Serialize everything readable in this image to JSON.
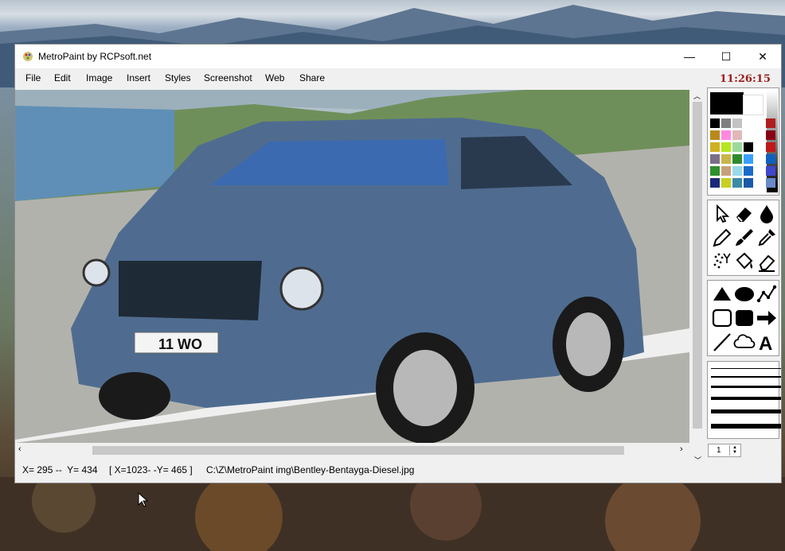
{
  "window": {
    "title": "MetroPaint by RCPsoft.net",
    "controls": {
      "minimize": "—",
      "maximize": "☐",
      "close": "✕"
    }
  },
  "menu": [
    "File",
    "Edit",
    "Image",
    "Insert",
    "Styles",
    "Screenshot",
    "Web",
    "Share"
  ],
  "status": {
    "cursor": "X= 295 --  Y= 434",
    "size": "[ X=1023- -Y= 465 ]",
    "path": "C:\\Z\\MetroPaint img\\Bentley-Bentayga-Diesel.jpg"
  },
  "panel": {
    "clock": "11:26:15",
    "line_width_value": "1",
    "primary_color": "#000000",
    "secondary_color": "#ffffff",
    "palette": [
      "#000000",
      "#7f7f7f",
      "#c3c3c3",
      "#ffffff",
      "#ffffff",
      "#b01e1e",
      "#b78a1a",
      "#ff88e0",
      "#e0b8b8",
      "#ffffff",
      "#ffffff",
      "#880015",
      "#cfb020",
      "#b5e61d",
      "#9bd99b",
      "#000000",
      "#ffffff",
      "#c01818",
      "#7a6f8a",
      "#c8b64a",
      "#2e8b2e",
      "#3aa0ff",
      "#ffffff",
      "#1060c0",
      "#2f8f2f",
      "#c8a07a",
      "#99d9ea",
      "#1a6cc8",
      "#ffffff",
      "#3f48cc",
      "#1a2a7a",
      "#c8d020",
      "#3a8aa8",
      "#1a5aa8",
      "#ffffff",
      "#6a8ac8"
    ],
    "tools": [
      "pointer-icon",
      "eraser-icon",
      "drop-icon",
      "pencil-icon",
      "brush-icon",
      "color-picker-icon",
      "spray-icon",
      "fill-bucket-icon",
      "highlighter-icon"
    ],
    "shapes": [
      "triangle-icon",
      "ellipse-icon",
      "polyline-icon",
      "rectangle-outline-icon",
      "rounded-rect-icon",
      "arrow-icon",
      "line-icon",
      "cloud-icon",
      "text-icon"
    ]
  }
}
